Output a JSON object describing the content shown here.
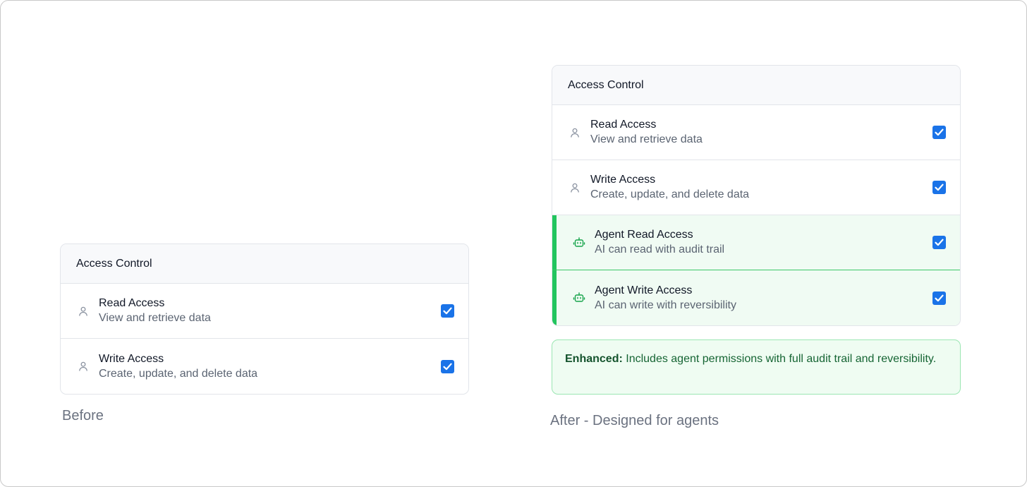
{
  "before": {
    "header": "Access Control",
    "rows": [
      {
        "title": "Read Access",
        "desc": "View and retrieve data",
        "checked": true,
        "icon": "user-icon"
      },
      {
        "title": "Write Access",
        "desc": "Create, update, and delete data",
        "checked": true,
        "icon": "user-icon"
      }
    ],
    "caption": "Before"
  },
  "after": {
    "header": "Access Control",
    "rows": [
      {
        "title": "Read Access",
        "desc": "View and retrieve data",
        "checked": true,
        "icon": "user-icon"
      },
      {
        "title": "Write Access",
        "desc": "Create, update, and delete data",
        "checked": true,
        "icon": "user-icon"
      },
      {
        "title": "Agent Read Access",
        "desc": "AI can read with audit trail",
        "checked": true,
        "icon": "robot-icon"
      },
      {
        "title": "Agent Write Access",
        "desc": "AI can write with reversibility",
        "checked": true,
        "icon": "robot-icon"
      }
    ],
    "note": {
      "strong": "Enhanced:",
      "text": " Includes agent permissions with full audit trail and reversibility."
    },
    "caption": "After - Designed for agents"
  },
  "colors": {
    "checkbox": "#1a73e8",
    "agent_accent": "#22c55e",
    "agent_background": "#f0fbf3",
    "note_text": "#166534"
  }
}
